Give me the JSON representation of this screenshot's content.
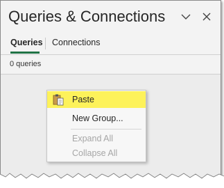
{
  "header": {
    "title": "Queries & Connections",
    "collapse_icon": "chevron-down-icon",
    "close_icon": "close-icon"
  },
  "tabs": [
    {
      "label": "Queries",
      "active": true
    },
    {
      "label": "Connections",
      "active": false
    }
  ],
  "status": {
    "count_text": "0 queries"
  },
  "context_menu": {
    "items": [
      {
        "label": "Paste",
        "icon": "paste-icon",
        "highlighted": true,
        "enabled": true
      },
      {
        "label": "New Group...",
        "enabled": true
      },
      {
        "label": "Expand All",
        "enabled": false
      },
      {
        "label": "Collapse All",
        "enabled": false
      }
    ]
  },
  "colors": {
    "accent_green": "#217346",
    "highlight_yellow": "#fdf25a",
    "disabled_text": "#a6a6a6"
  }
}
